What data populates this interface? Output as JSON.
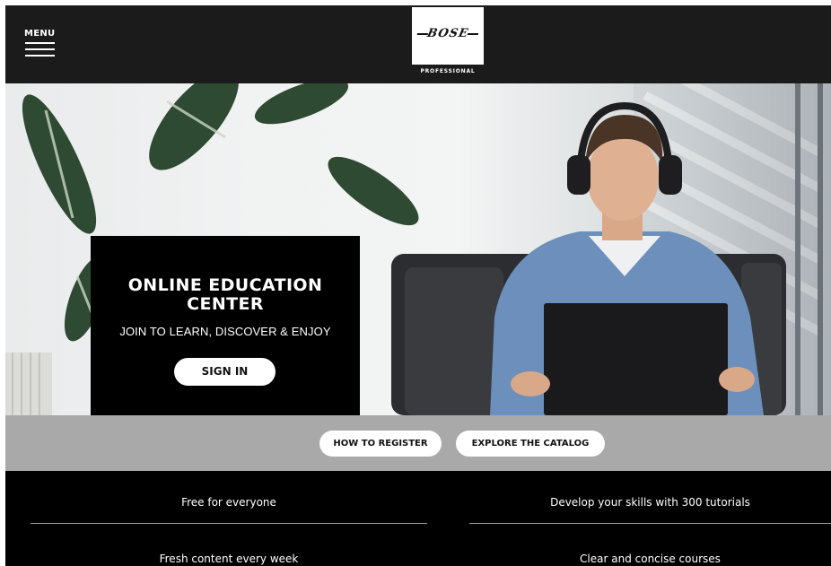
{
  "header": {
    "menu_label": "MENU",
    "logo_word": "BOSE",
    "logo_sub": "PROFESSIONAL"
  },
  "hero": {
    "title_line1": "ONLINE EDUCATION",
    "title_line2": "CENTER",
    "subtitle": "JOIN TO LEARN, DISCOVER & ENJOY",
    "signin_label": "SIGN IN"
  },
  "band": {
    "register_label": "HOW TO REGISTER",
    "catalog_label": "EXPLORE THE CATALOG"
  },
  "features": [
    {
      "text": "Free for everyone"
    },
    {
      "text": "Develop your skills with 300 tutorials"
    },
    {
      "text": "Fresh content every week"
    },
    {
      "text": "Clear and concise courses"
    }
  ]
}
